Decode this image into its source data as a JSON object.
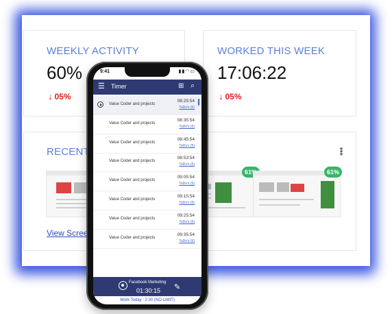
{
  "dashboard": {
    "weekly_activity": {
      "title": "WEEKLY ACTIVITY",
      "value": "60%",
      "change": "05%"
    },
    "worked_this_week": {
      "title": "WORKED THIS WEEK",
      "value": "17:06:22",
      "change": "05%"
    },
    "recent_activity": {
      "title": "RECENT A",
      "view_link": "View Screen",
      "screenshots": [
        {
          "badge": ""
        },
        {
          "badge": "61%"
        },
        {
          "badge": "61%"
        }
      ]
    }
  },
  "phone": {
    "status_time": "9:41",
    "header_title": "Timer",
    "tasks": [
      {
        "name": "Value Coder and projects",
        "time": "08:25:54",
        "todo": "ToDo's (5)"
      },
      {
        "name": "Value Coder and projects",
        "time": "08:35:54",
        "todo": "ToDo's (5)"
      },
      {
        "name": "Value Coder and projects",
        "time": "08:45:54",
        "todo": "ToDo's (5)"
      },
      {
        "name": "Value Coder and projects",
        "time": "08:53:54",
        "todo": "ToDo's (5)"
      },
      {
        "name": "Value Coder and projects",
        "time": "09:05:54",
        "todo": "ToDo's (5)"
      },
      {
        "name": "Value Coder and projects",
        "time": "09:15:54",
        "todo": "ToDo's (5)"
      },
      {
        "name": "Value Coder and projects",
        "time": "09:25:54",
        "todo": "ToDo's (5)"
      },
      {
        "name": "Value Coder and projects",
        "time": "09:35:54",
        "todo": "ToDo's (5)"
      }
    ],
    "footer": {
      "project": "Facebook Marketing",
      "timer": "01:30:15",
      "work_today": "Work Today : 2:30 (NO LIMIT)"
    }
  },
  "colors": {
    "accent": "#3a56e0",
    "header": "#2f3a73",
    "title": "#5b7fd6",
    "negative": "#e02020",
    "badge": "#38b46a"
  }
}
